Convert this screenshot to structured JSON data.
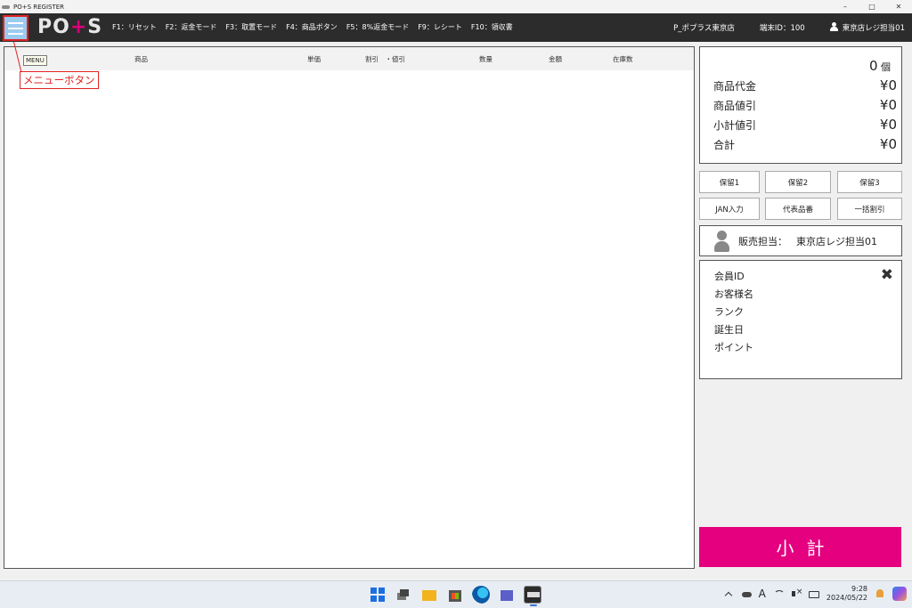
{
  "window": {
    "title": "PO+S REGISTER",
    "controls": [
      "–",
      "□",
      "✕"
    ]
  },
  "header": {
    "logo_left": "PO",
    "logo_plus": "+",
    "logo_right": "S",
    "fkeys": [
      "F1：リセット",
      "F2：返金モード",
      "F3：取置モード",
      "F4：商品ボタン",
      "F5：8%返金モード",
      "F9：レシート",
      "F10：領収書"
    ],
    "store": "P_ポプラス東京店",
    "terminal": "端末ID：100",
    "user": "東京店レジ担当01"
  },
  "annotation": {
    "tooltip": "MENU",
    "callout": "メニューボタン"
  },
  "table": {
    "columns": [
      "商品",
      "単価",
      "割引　・値引",
      "数量",
      "金額",
      "在庫数"
    ]
  },
  "totals": {
    "count_value": "0",
    "count_unit": "個",
    "rows": [
      {
        "label": "商品代金",
        "value": "¥0"
      },
      {
        "label": "商品値引",
        "value": "¥0"
      },
      {
        "label": "小計値引",
        "value": "¥0"
      },
      {
        "label": "合計",
        "value": "¥0"
      }
    ]
  },
  "buttons": {
    "hold1": "保留1",
    "hold2": "保留2",
    "hold3": "保留3",
    "jan": "JAN入力",
    "rep_item": "代表品番",
    "bulk_discount": "一括割引"
  },
  "staff": {
    "label": "販売担当：",
    "name": "東京店レジ担当01"
  },
  "member": {
    "fields": [
      "会員ID",
      "お客様名",
      "ランク",
      "誕生日",
      "ポイント"
    ],
    "close": "✖"
  },
  "subtotal": "小計",
  "taskbar": {
    "ime": "A",
    "time": "9:28",
    "date": "2024/05/22"
  }
}
